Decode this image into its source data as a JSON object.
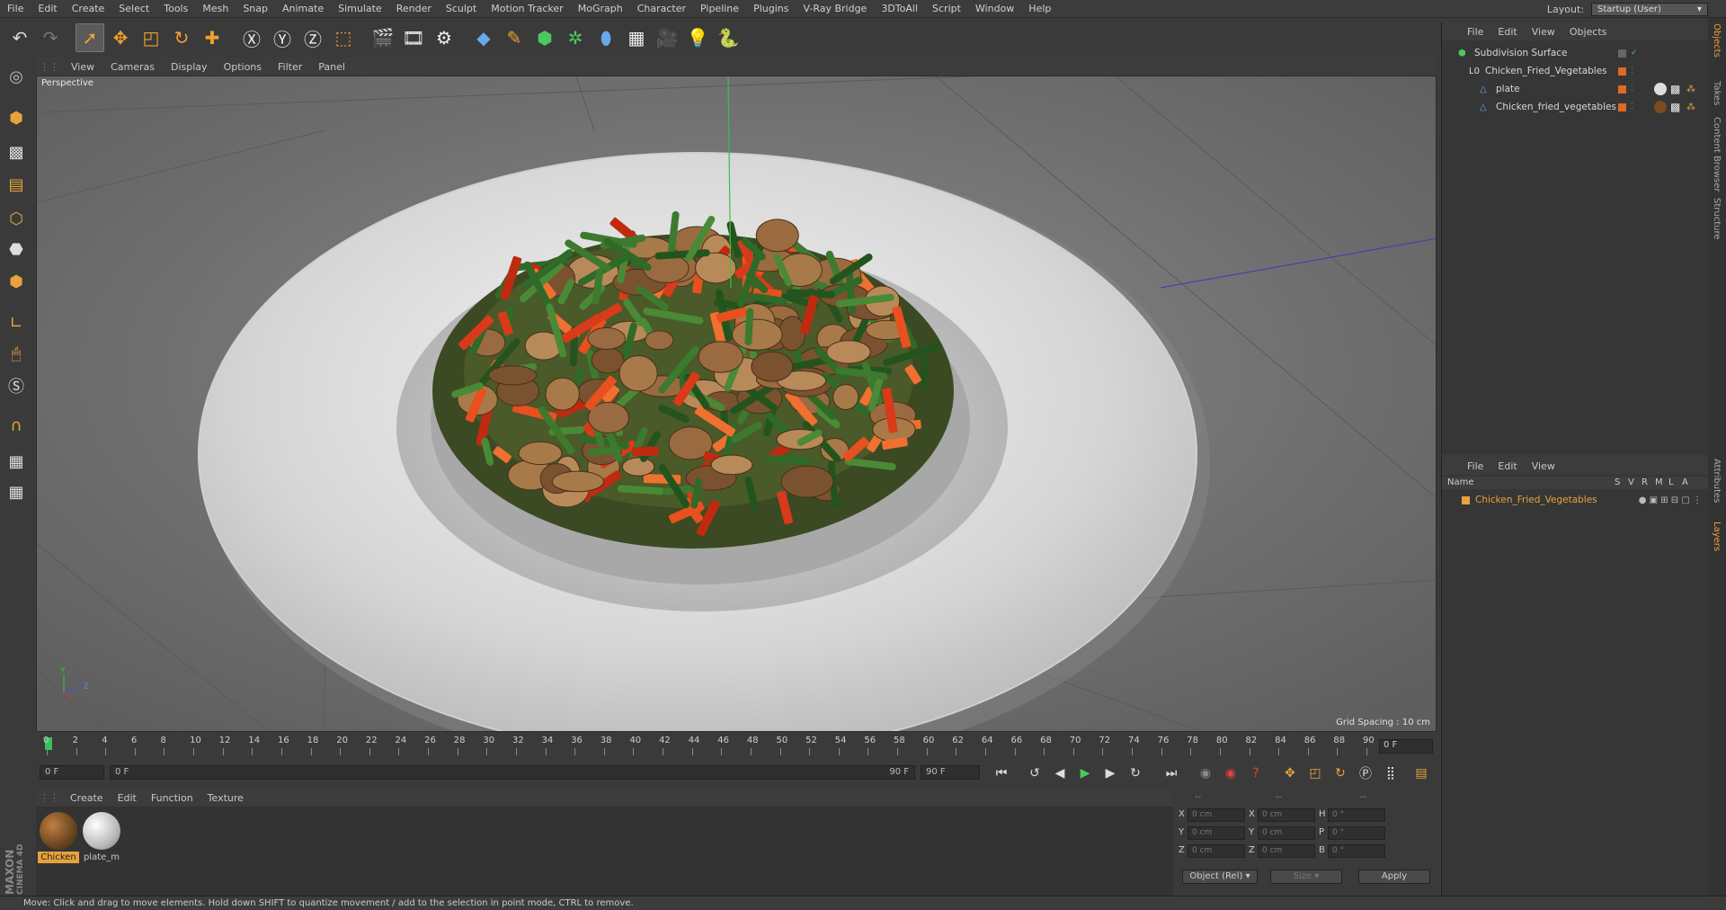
{
  "menubar": {
    "items": [
      "File",
      "Edit",
      "Create",
      "Select",
      "Tools",
      "Mesh",
      "Snap",
      "Animate",
      "Simulate",
      "Render",
      "Sculpt",
      "Motion Tracker",
      "MoGraph",
      "Character",
      "Pipeline",
      "Plugins",
      "V-Ray Bridge",
      "3DToAll",
      "Script",
      "Window",
      "Help"
    ],
    "layout_label": "Layout:",
    "layout_value": "Startup (User)"
  },
  "toolbar": {
    "icons": [
      "undo-icon",
      "redo-icon",
      "select-arrow-icon",
      "move-icon",
      "scale-icon",
      "rotate-icon",
      "live-select-icon",
      "x-axis-icon",
      "y-axis-icon",
      "z-axis-icon",
      "coord-system-icon",
      "render-view-icon",
      "render-picture-viewer-icon",
      "render-settings-icon",
      "cube-primitive-icon",
      "pen-icon",
      "subdivision-icon",
      "cloner-icon",
      "deformer-icon",
      "floor-icon",
      "camera-icon",
      "light-icon",
      "python-icon"
    ]
  },
  "viewport": {
    "menu": [
      "View",
      "Cameras",
      "Display",
      "Options",
      "Filter",
      "Panel"
    ],
    "label": "Perspective",
    "grid_spacing": "Grid Spacing : 10 cm"
  },
  "timeline": {
    "ticks": [
      "0",
      "2",
      "4",
      "6",
      "8",
      "10",
      "12",
      "14",
      "16",
      "18",
      "20",
      "22",
      "24",
      "26",
      "28",
      "30",
      "32",
      "34",
      "36",
      "38",
      "40",
      "42",
      "44",
      "46",
      "48",
      "50",
      "52",
      "54",
      "56",
      "58",
      "60",
      "62",
      "64",
      "66",
      "68",
      "70",
      "72",
      "74",
      "76",
      "78",
      "80",
      "82",
      "84",
      "86",
      "88",
      "90"
    ],
    "current_frame": "0 F",
    "start_field": "0 F",
    "range_start": "0 F",
    "range_end": "90 F",
    "end_field": "90 F"
  },
  "materials": {
    "menu": [
      "Create",
      "Edit",
      "Function",
      "Texture"
    ],
    "items": [
      {
        "label": "Chicken",
        "color": "#8a5a2e",
        "selected": true
      },
      {
        "label": "plate_m",
        "color": "#d8d8d8",
        "selected": false
      }
    ]
  },
  "coordinates": {
    "header": [
      "--",
      "--",
      "--"
    ],
    "rows": [
      {
        "a": "X",
        "av": "0 cm",
        "b": "X",
        "bv": "0 cm",
        "c": "H",
        "cv": "0 °"
      },
      {
        "a": "Y",
        "av": "0 cm",
        "b": "Y",
        "bv": "0 cm",
        "c": "P",
        "cv": "0 °"
      },
      {
        "a": "Z",
        "av": "0 cm",
        "b": "Z",
        "bv": "0 cm",
        "c": "B",
        "cv": "0 °"
      }
    ],
    "mode": "Object (Rel)",
    "size": "Size",
    "apply": "Apply"
  },
  "objects": {
    "menu": [
      "File",
      "Edit",
      "View",
      "Objects"
    ],
    "rows": [
      {
        "name": "Subdivision Surface",
        "indent": 0,
        "color": "#4cc85c"
      },
      {
        "name": "Chicken_Fried_Vegetables",
        "indent": 1,
        "color": "#dddddd"
      },
      {
        "name": "plate",
        "indent": 2,
        "color": "#6aa8e8"
      },
      {
        "name": "Chicken_fried_vegetables",
        "indent": 2,
        "color": "#6aa8e8"
      }
    ]
  },
  "layers": {
    "menu": [
      "File",
      "Edit",
      "View"
    ],
    "header": {
      "name": "Name",
      "cols": [
        "S",
        "V",
        "R",
        "M",
        "L",
        "A"
      ]
    },
    "rows": [
      {
        "name": "Chicken_Fried_Vegetables",
        "color": "#e9a23b"
      }
    ]
  },
  "side_tabs": [
    "Objects",
    "Takes",
    "Content Browser",
    "Structure",
    "Attributes",
    "Layers"
  ],
  "brand": {
    "line1": "MAXON",
    "line2": "CINEMA 4D"
  },
  "status": "Move: Click and drag to move elements. Hold down SHIFT to quantize movement / add to the selection in point mode, CTRL to remove."
}
